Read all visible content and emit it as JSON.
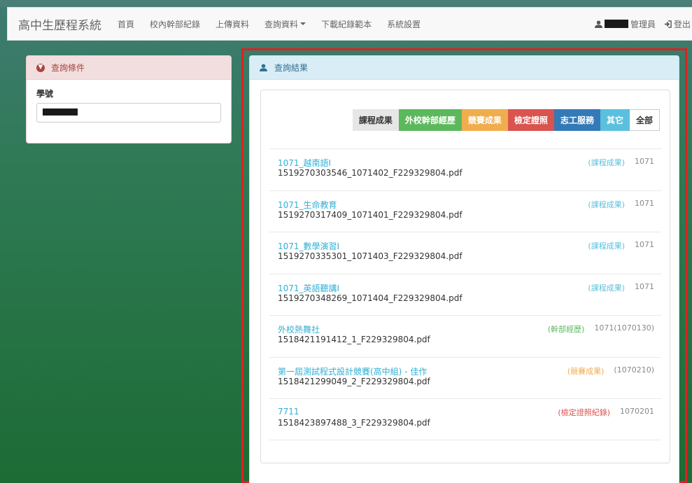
{
  "navbar": {
    "brand": "高中生歷程系統",
    "items": [
      "首頁",
      "校內幹部紀錄",
      "上傳資料",
      "查詢資料",
      "下載紀錄範本",
      "系統設置"
    ],
    "dropdown_index": 3,
    "user_role": "管理員",
    "logout": "登出"
  },
  "query_panel": {
    "title": "查詢條件",
    "field_label": "學號"
  },
  "results_panel": {
    "title": "查詢結果",
    "tabs": [
      {
        "label": "課程成果",
        "bg": "#e6e6e6",
        "fg": "#333333"
      },
      {
        "label": "外校幹部經歷",
        "bg": "#5cb85c",
        "fg": "#ffffff"
      },
      {
        "label": "競賽成果",
        "bg": "#f0ad4e",
        "fg": "#ffffff"
      },
      {
        "label": "檢定證照",
        "bg": "#d9534f",
        "fg": "#ffffff"
      },
      {
        "label": "志工服務",
        "bg": "#337ab7",
        "fg": "#ffffff"
      },
      {
        "label": "其它",
        "bg": "#5bc0de",
        "fg": "#ffffff"
      },
      {
        "label": "全部",
        "bg": "#ffffff",
        "fg": "#333333"
      }
    ],
    "records": [
      {
        "title": "1071_越南語I",
        "file": "1519270303546_1071402_F229329804.pdf",
        "category": "(課程成果)",
        "category_color": "#5bc0de",
        "year": "1071"
      },
      {
        "title": "1071_生命教育",
        "file": "1519270317409_1071401_F229329804.pdf",
        "category": "(課程成果)",
        "category_color": "#5bc0de",
        "year": "1071"
      },
      {
        "title": "1071_數學演習I",
        "file": "1519270335301_1071403_F229329804.pdf",
        "category": "(課程成果)",
        "category_color": "#5bc0de",
        "year": "1071"
      },
      {
        "title": "1071_英語聽講I",
        "file": "1519270348269_1071404_F229329804.pdf",
        "category": "(課程成果)",
        "category_color": "#5bc0de",
        "year": "1071"
      },
      {
        "title": "外校熱舞社",
        "file": "1518421191412_1_F229329804.pdf",
        "category": "(幹部經歷)",
        "category_color": "#5cb85c",
        "year": "1071(1070130)"
      },
      {
        "title": "第一屆測試程式設計競賽(高中組) - 佳作",
        "file": "1518421299049_2_F229329804.pdf",
        "category": "(競賽成果)",
        "category_color": "#f0ad4e",
        "year": "(1070210)"
      },
      {
        "title": "7711",
        "file": "1518423897488_3_F229329804.pdf",
        "category": "(檢定證照紀錄)",
        "category_color": "#d9534f",
        "year": "1070201"
      }
    ]
  }
}
